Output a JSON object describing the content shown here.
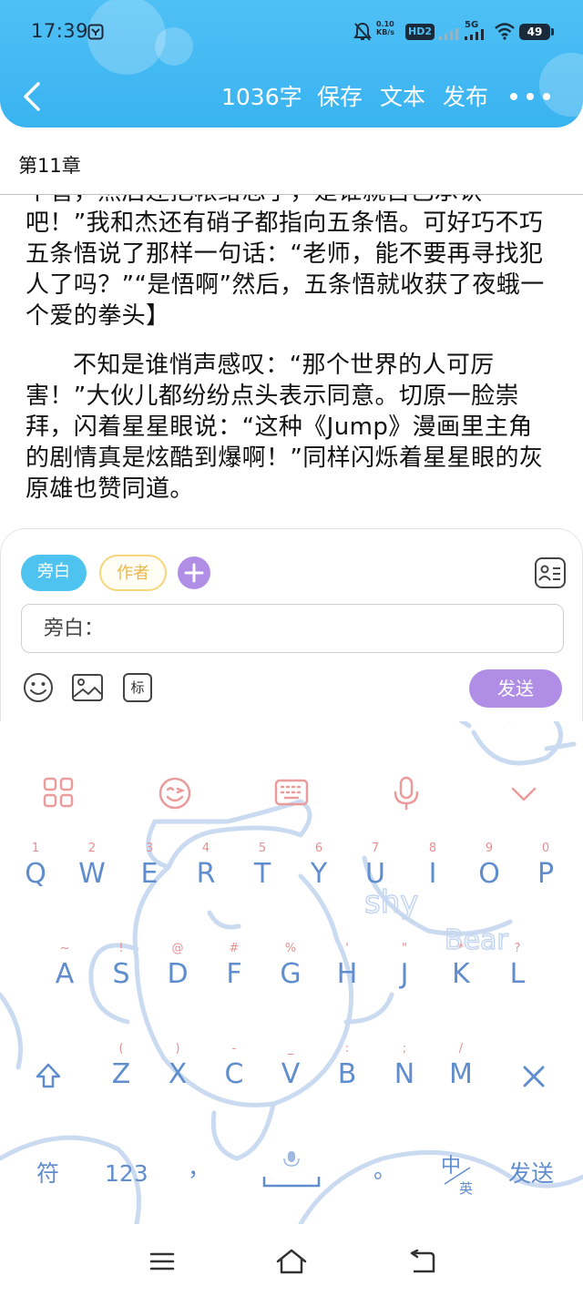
{
  "status_bar": {
    "time": "17:39",
    "net_speed_value": "0.10",
    "net_speed_unit": "KB/s",
    "hd_label": "HD2",
    "network_label": "5G",
    "battery": "49"
  },
  "toolbar": {
    "word_count": "1036字",
    "save": "保存",
    "text": "文本",
    "publish": "发布"
  },
  "chapter": {
    "title": "第11章"
  },
  "story": {
    "paragraphs": [
      "不管，然后还把帐给忘了，是谁就自己承认吧！”我和杰还有硝子都指向五条悟。可好巧不巧五条悟说了那样一句话：“老师，能不要再寻找犯人了吗？”“是悟啊”然后，五条悟就收获了夜蛾一个爱的拳头】",
      "不知是谁悄声感叹：“那个世界的人可厉害！”大伙儿都纷纷点头表示同意。切原一脸崇拜，闪着星星眼说：“这种《Jump》漫画里主角的剧情真是炫酷到爆啊！”同样闪烁着星星眼的灰原雄也赞同道。"
    ]
  },
  "composer": {
    "roles": [
      "旁白",
      "作者"
    ],
    "input_placeholder": "旁白：",
    "tag_label": "标",
    "send_label": "发送"
  },
  "keyboard": {
    "row1": [
      {
        "main": "Q",
        "sub": "1"
      },
      {
        "main": "W",
        "sub": "2"
      },
      {
        "main": "E",
        "sub": "3"
      },
      {
        "main": "R",
        "sub": "4"
      },
      {
        "main": "T",
        "sub": "5"
      },
      {
        "main": "Y",
        "sub": "6"
      },
      {
        "main": "U",
        "sub": "7"
      },
      {
        "main": "I",
        "sub": "8"
      },
      {
        "main": "O",
        "sub": "9"
      },
      {
        "main": "P",
        "sub": "0"
      }
    ],
    "row2": [
      {
        "main": "A",
        "sub": "~"
      },
      {
        "main": "S",
        "sub": "!"
      },
      {
        "main": "D",
        "sub": "@"
      },
      {
        "main": "F",
        "sub": "#"
      },
      {
        "main": "G",
        "sub": "%"
      },
      {
        "main": "H",
        "sub": "'"
      },
      {
        "main": "J",
        "sub": "\""
      },
      {
        "main": "K",
        "sub": "*"
      },
      {
        "main": "L",
        "sub": "?"
      }
    ],
    "row3": [
      {
        "main": "Z",
        "sub": "("
      },
      {
        "main": "X",
        "sub": ")"
      },
      {
        "main": "C",
        "sub": "-"
      },
      {
        "main": "V",
        "sub": "_"
      },
      {
        "main": "B",
        "sub": ":"
      },
      {
        "main": "N",
        "sub": ";"
      },
      {
        "main": "M",
        "sub": "/"
      }
    ],
    "bottom": {
      "symbols": "符",
      "numbers": "123",
      "comma": "，",
      "period": "。",
      "lang_top": "中",
      "lang_bottom": "英",
      "send": "发送"
    },
    "deco_text": [
      "shy",
      "Bear"
    ]
  },
  "colors": {
    "header": "#39b3f0",
    "accent_purple": "#b18ee5",
    "chip_blue": "#4fc3ef",
    "key_blue": "#5f8dcd",
    "key_sub_pink": "#e59090"
  }
}
